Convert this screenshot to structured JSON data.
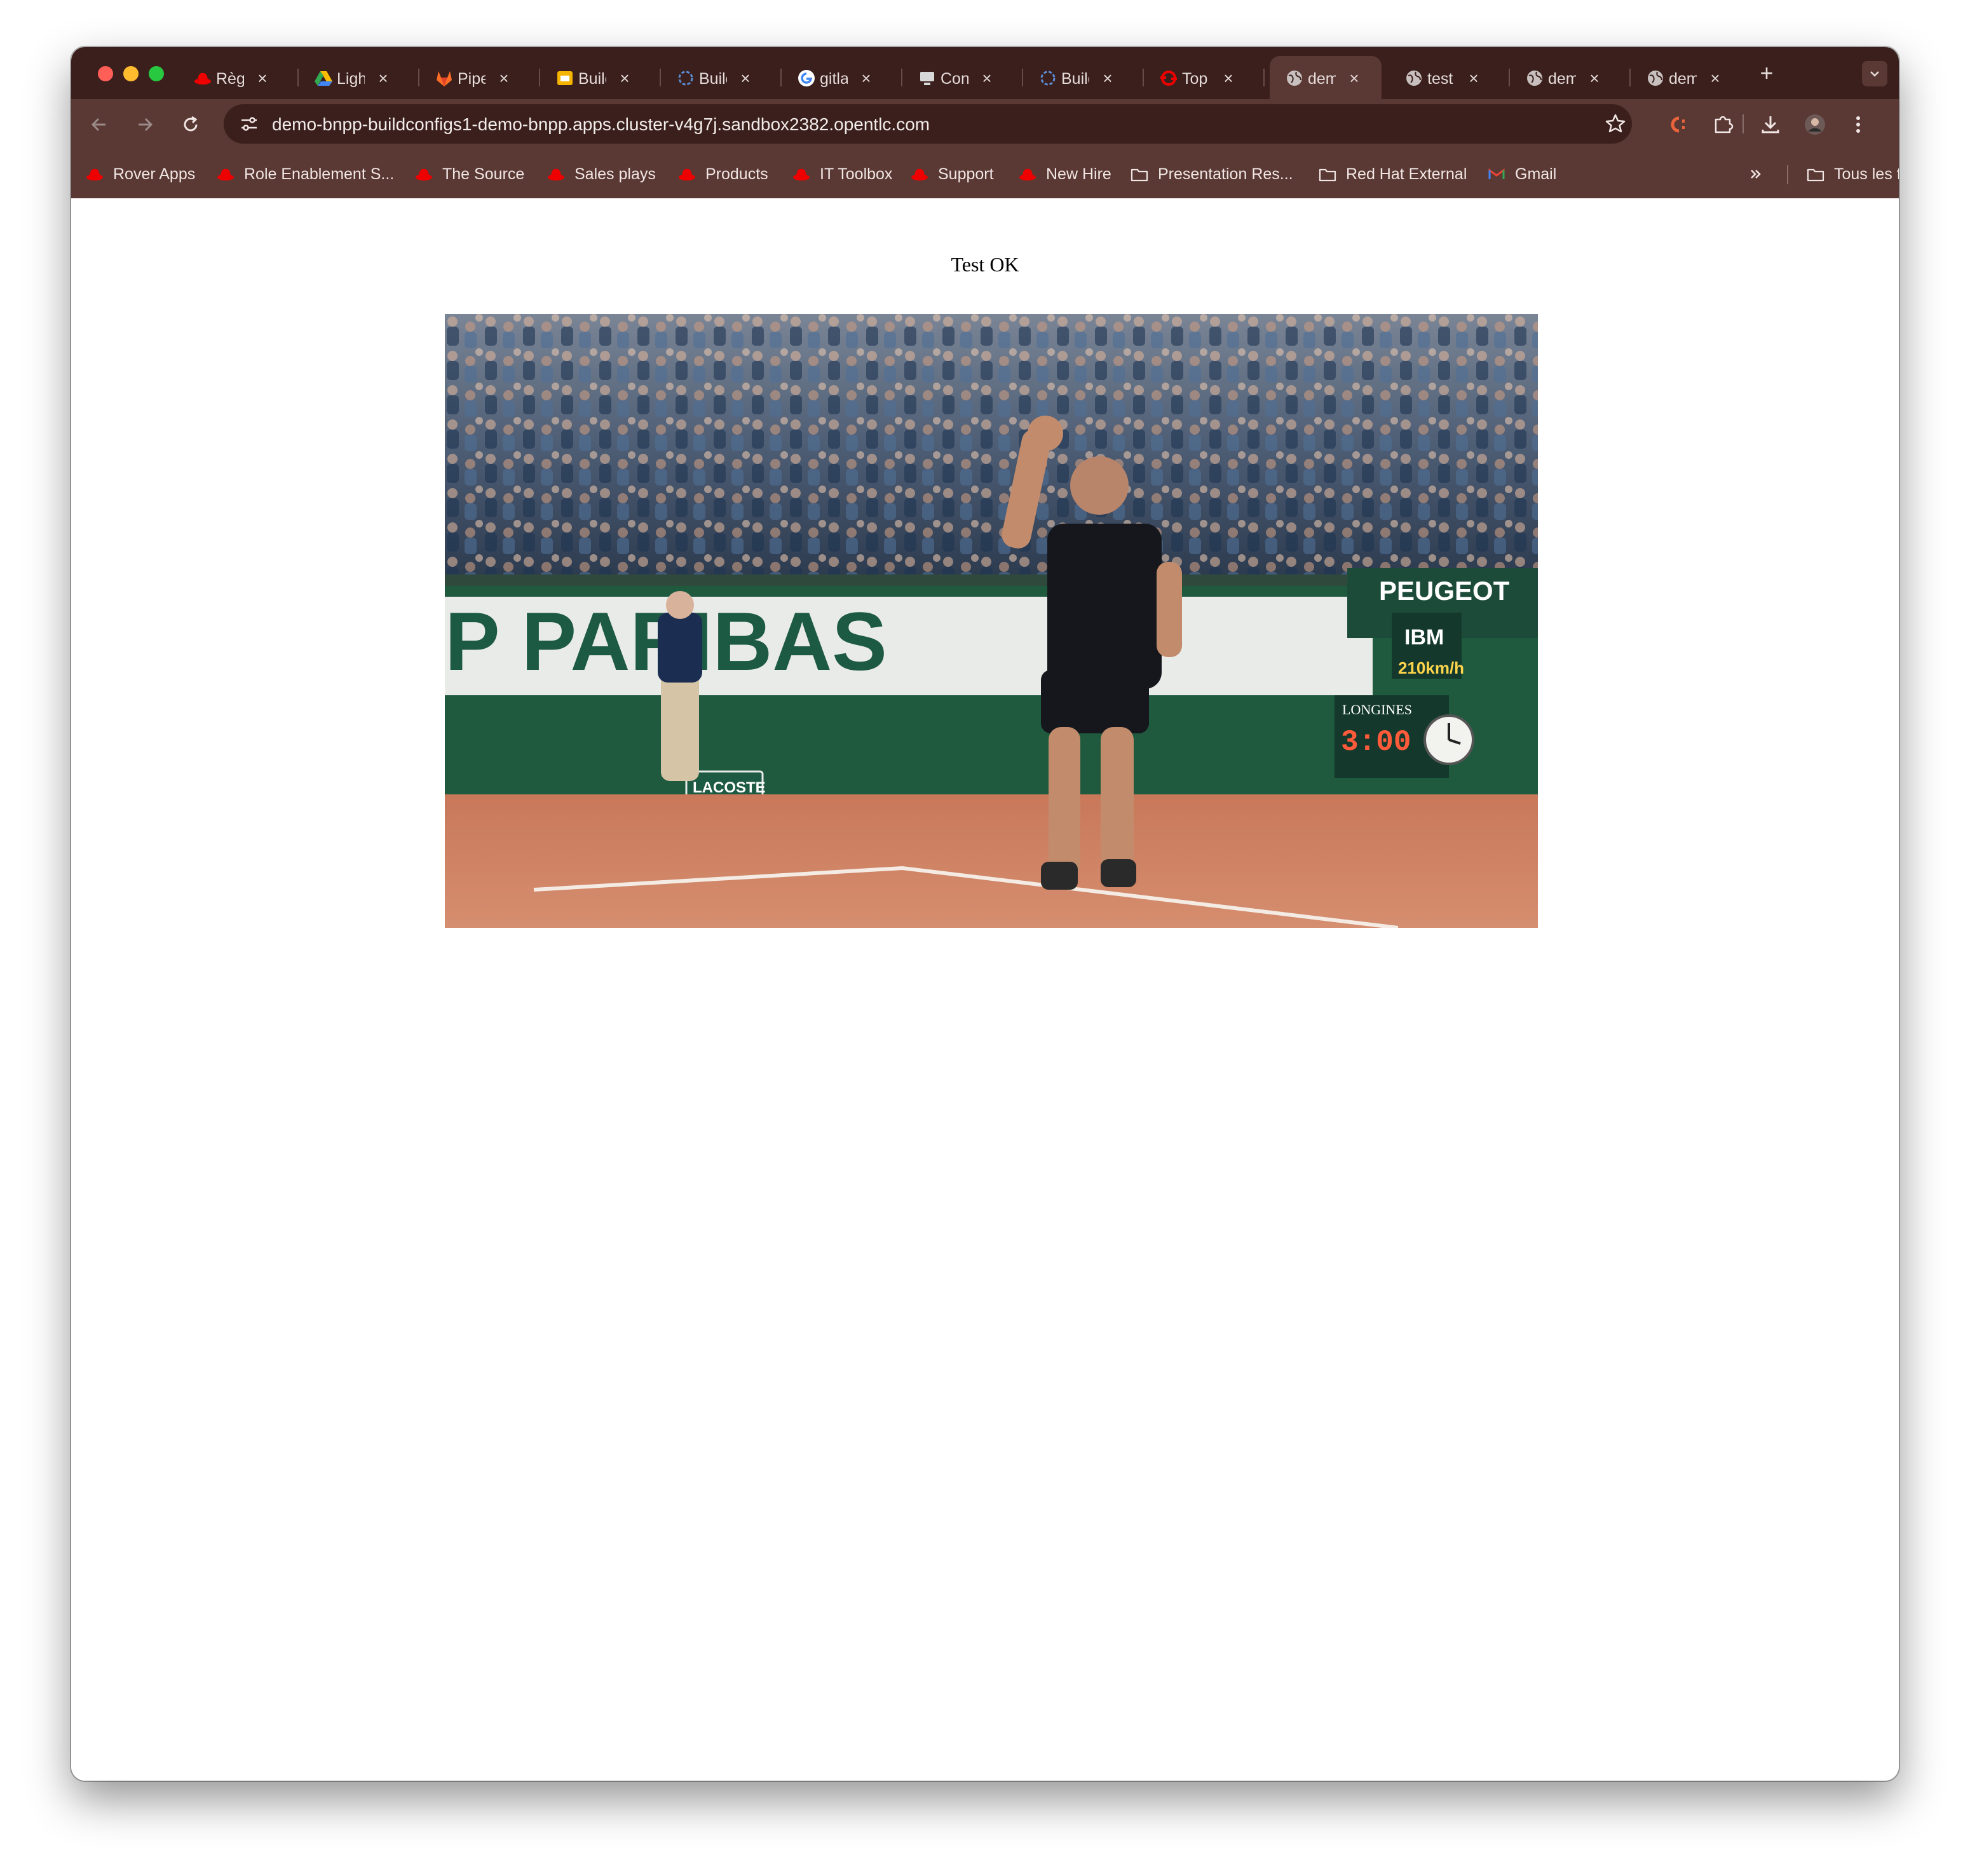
{
  "browser": {
    "tabs": [
      {
        "title": "Règl",
        "icon": "redhat-icon",
        "active": false
      },
      {
        "title": "Ligh",
        "icon": "google-drive-icon",
        "active": false
      },
      {
        "title": "Pipe",
        "icon": "gitlab-icon",
        "active": false
      },
      {
        "title": "Builc",
        "icon": "google-slides-icon",
        "active": false
      },
      {
        "title": "Builc",
        "icon": "tekton-icon",
        "active": false
      },
      {
        "title": "gitla",
        "icon": "google-icon",
        "active": false
      },
      {
        "title": "Con",
        "icon": "computer-icon",
        "active": false
      },
      {
        "title": "Builc",
        "icon": "tekton-icon",
        "active": false
      },
      {
        "title": "Top",
        "icon": "openshift-icon",
        "active": false
      },
      {
        "title": "dem",
        "icon": "globe-icon",
        "active": true
      },
      {
        "title": "test",
        "icon": "globe-icon",
        "active": false
      },
      {
        "title": "dem",
        "icon": "globe-icon",
        "active": false
      },
      {
        "title": "dem",
        "icon": "globe-icon",
        "active": false
      }
    ],
    "url": "demo-bnpp-buildconfigs1-demo-bnpp.apps.cluster-v4g7j.sandbox2382.opentlc.com",
    "bookmarks": [
      {
        "label": "Rover Apps",
        "icon": "redhat-icon"
      },
      {
        "label": "Role Enablement S...",
        "icon": "redhat-icon"
      },
      {
        "label": "The Source",
        "icon": "redhat-icon"
      },
      {
        "label": "Sales plays",
        "icon": "redhat-icon"
      },
      {
        "label": "Products",
        "icon": "redhat-icon"
      },
      {
        "label": "IT Toolbox",
        "icon": "redhat-icon"
      },
      {
        "label": "Support",
        "icon": "redhat-icon"
      },
      {
        "label": "New Hire",
        "icon": "redhat-icon"
      },
      {
        "label": "Presentation Res...",
        "icon": "folder-icon"
      },
      {
        "label": "Red Hat External",
        "icon": "folder-icon"
      },
      {
        "label": "Gmail",
        "icon": "gmail-icon"
      }
    ],
    "all_bookmarks_label": "Tous les favoris",
    "colors": {
      "frame": "#3a1f1c",
      "toolbar": "#5a3834",
      "redhat": "#ee0000"
    }
  },
  "page": {
    "heading": "Test OK",
    "image": {
      "signage": [
        "P PARIBAS",
        "PEUGEOT",
        "LACOSTE",
        "LONGINES",
        "3:00",
        "IBM",
        "210km/h"
      ]
    }
  }
}
